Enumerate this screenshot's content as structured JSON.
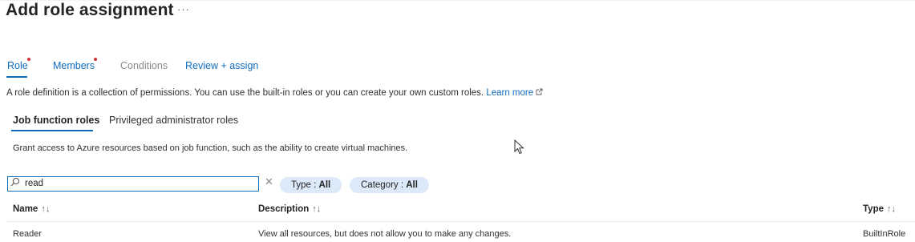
{
  "header": {
    "title": "Add role assignment",
    "more": "···"
  },
  "tabs": [
    {
      "label": "Role",
      "state": "active",
      "required": true
    },
    {
      "label": "Members",
      "state": "normal",
      "required": true
    },
    {
      "label": "Conditions",
      "state": "disabled",
      "required": false
    },
    {
      "label": "Review + assign",
      "state": "normal",
      "required": false
    }
  ],
  "role_description": {
    "text": "A role definition is a collection of permissions. You can use the built-in roles or you can create your own custom roles.",
    "link_label": "Learn more",
    "link_icon": "external-link-icon"
  },
  "subtabs": [
    {
      "label": "Job function roles",
      "active": true
    },
    {
      "label": "Privileged administrator roles",
      "active": false
    }
  ],
  "subtab_description": "Grant access to Azure resources based on job function, such as the ability to create virtual machines.",
  "search": {
    "icon": "search-icon",
    "value": "read"
  },
  "filters": {
    "type": {
      "label": "Type : ",
      "value": "All"
    },
    "category": {
      "label": "Category : ",
      "value": "All"
    }
  },
  "table": {
    "columns": [
      {
        "label": "Name",
        "sort": "↑↓"
      },
      {
        "label": "Description",
        "sort": "↑↓"
      },
      {
        "label": "Type",
        "sort": "↑↓"
      }
    ],
    "rows": [
      {
        "name": "Reader",
        "description": "View all resources, but does not allow you to make any changes.",
        "type": "BuiltInRole"
      }
    ]
  },
  "colors": {
    "accent": "#0f6cbd",
    "required_dot": "#d13438",
    "pill_bg": "#dbe9f8"
  }
}
